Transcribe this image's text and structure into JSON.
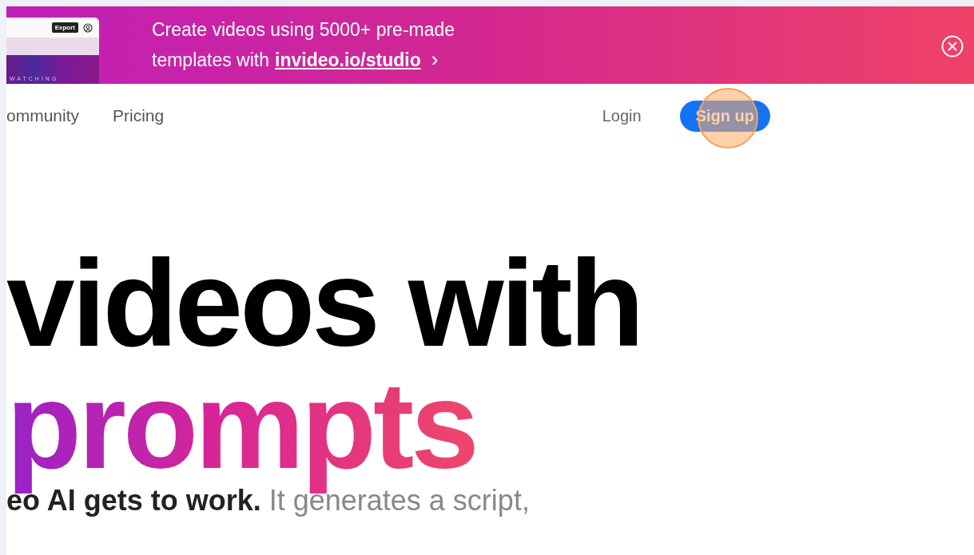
{
  "banner": {
    "thumbnail": {
      "badge": "Export",
      "caption": "WATCHING"
    },
    "text_line_1": "Create videos using 5000+ pre-made",
    "text_line_2_prefix": "templates with",
    "link": "invideo.io/studio",
    "chevron": "›"
  },
  "nav": {
    "links": [
      {
        "label": "ommunity"
      },
      {
        "label": "Pricing"
      }
    ],
    "login": "Login",
    "signup": {
      "label": "Sign up",
      "highlighted": true
    }
  },
  "hero": {
    "heading_line_1": "videos with",
    "heading_line_2": "prompts",
    "subtext": "**eo AI gets to work.** It generates a script,"
  }
}
